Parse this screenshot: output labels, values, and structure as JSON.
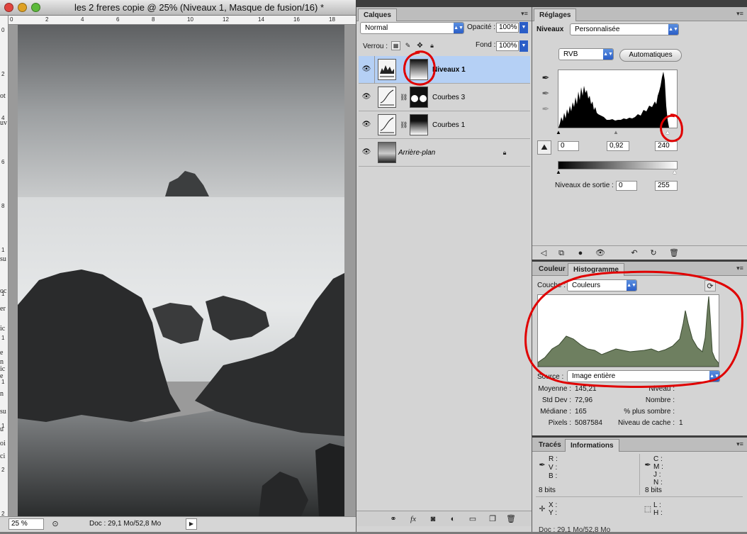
{
  "document": {
    "title": "les 2 freres copie @ 25% (Niveaux 1, Masque de fusion/16) *",
    "zoom": "25 %",
    "doc_info": "Doc : 29,1 Mo/52,8 Mo",
    "ruler_top": [
      "0",
      "2",
      "4",
      "6",
      "8",
      "10",
      "12",
      "14",
      "16",
      "18"
    ],
    "ruler_left": [
      "0",
      "2",
      "4",
      "6",
      "8",
      "1",
      "1",
      "1",
      "1",
      "1",
      "2",
      "2"
    ],
    "left_partial_text": [
      "ot",
      "uv",
      "su",
      "oc",
      "er",
      "ic",
      "e",
      "n",
      "ic",
      "e",
      "n",
      "su",
      "u",
      "oi",
      "ci"
    ]
  },
  "layers_panel": {
    "tab": "Calques",
    "blend_mode": "Normal",
    "opacity_label": "Opacité :",
    "opacity_value": "100%",
    "lock_label": "Verrou :",
    "fill_label": "Fond :",
    "fill_value": "100%",
    "layers": [
      {
        "name": "Niveaux 1",
        "selected": true
      },
      {
        "name": "Courbes 3",
        "selected": false
      },
      {
        "name": "Courbes 1",
        "selected": false
      },
      {
        "name": "Arrière-plan",
        "selected": false
      }
    ]
  },
  "adjustments_panel": {
    "tab": "Réglages",
    "type_label": "Niveaux",
    "preset": "Personnalisée",
    "channel": "RVB",
    "auto_button": "Automatiques",
    "input_black": "0",
    "input_gamma": "0,92",
    "input_white": "240",
    "output_label": "Niveaux de sortie :",
    "output_black": "0",
    "output_white": "255"
  },
  "histogram_panel": {
    "tabs": [
      "Couleur",
      "Histogramme"
    ],
    "channel_label": "Couche :",
    "channel_value": "Couleurs",
    "source_label": "Source :",
    "source_value": "Image entière",
    "stats_left": [
      {
        "label": "Moyenne :",
        "value": "145,21"
      },
      {
        "label": "Std Dev :",
        "value": "72,96"
      },
      {
        "label": "Médiane :",
        "value": "165"
      },
      {
        "label": "Pixels :",
        "value": "5087584"
      }
    ],
    "stats_right": [
      {
        "label": "Niveau :",
        "value": ""
      },
      {
        "label": "Nombre :",
        "value": ""
      },
      {
        "label": "% plus sombre :",
        "value": ""
      },
      {
        "label": "Niveau de cache :",
        "value": "1"
      }
    ],
    "fill_color": "#6e7f60"
  },
  "info_panel": {
    "tabs": [
      "Tracés",
      "Informations"
    ],
    "rvb_labels": [
      "R :",
      "V :",
      "B :"
    ],
    "cmjn_labels": [
      "C :",
      "M :",
      "J :",
      "N :"
    ],
    "bits_left": "8 bits",
    "bits_right": "8 bits",
    "xy_labels": [
      "X :",
      "Y :"
    ],
    "lh_labels": [
      "L :",
      "H :"
    ],
    "bottom_partial": "Doc : 29,1 Mo/52,8 Mo"
  },
  "colors": {
    "annotation_red": "#e00000",
    "selection_blue": "#b5d0f5",
    "accent_blue": "#2b5ec7"
  }
}
